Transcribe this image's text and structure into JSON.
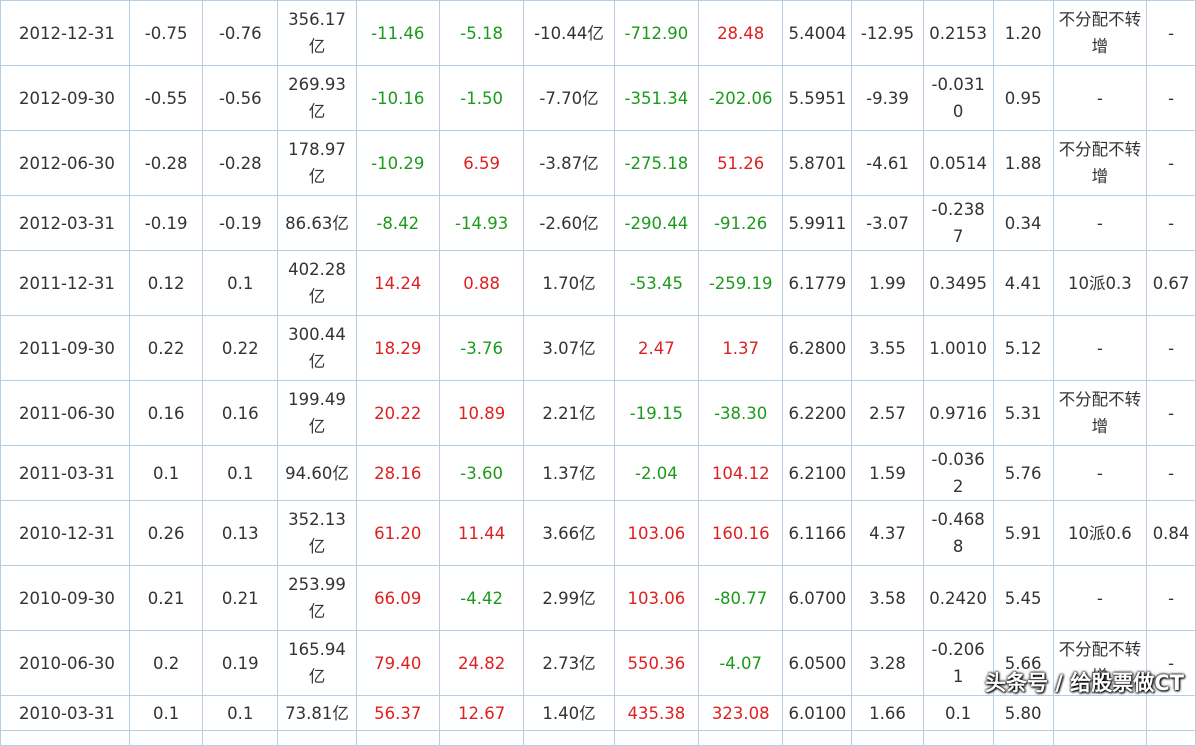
{
  "colors": {
    "up": "#e02020",
    "down": "#1c9a1c",
    "border": "#b8cfe3",
    "text": "#333333"
  },
  "rows": [
    {
      "date": "2012-12-31",
      "c1": "-0.75",
      "c2": "-0.76",
      "revenue": "356.17亿",
      "c4": "-11.46",
      "c5": "-5.18",
      "c6": "-10.44亿",
      "c7": "-712.90",
      "c8": "28.48",
      "c9": "5.4004",
      "c10": "-12.95",
      "c11": "0.2153",
      "c12": "1.20",
      "dist": "不分配不转增",
      "c14": "-"
    },
    {
      "date": "2012-09-30",
      "c1": "-0.55",
      "c2": "-0.56",
      "revenue": "269.93亿",
      "c4": "-10.16",
      "c5": "-1.50",
      "c6": "-7.70亿",
      "c7": "-351.34",
      "c8": "-202.06",
      "c9": "5.5951",
      "c10": "-9.39",
      "c11": "-0.0310",
      "c12": "0.95",
      "dist": "-",
      "c14": "-"
    },
    {
      "date": "2012-06-30",
      "c1": "-0.28",
      "c2": "-0.28",
      "revenue": "178.97亿",
      "c4": "-10.29",
      "c5": "6.59",
      "c6": "-3.87亿",
      "c7": "-275.18",
      "c8": "51.26",
      "c9": "5.8701",
      "c10": "-4.61",
      "c11": "0.0514",
      "c12": "1.88",
      "dist": "不分配不转增",
      "c14": "-"
    },
    {
      "date": "2012-03-31",
      "c1": "-0.19",
      "c2": "-0.19",
      "revenue": "86.63亿",
      "c4": "-8.42",
      "c5": "-14.93",
      "c6": "-2.60亿",
      "c7": "-290.44",
      "c8": "-91.26",
      "c9": "5.9911",
      "c10": "-3.07",
      "c11": "-0.2387",
      "c12": "0.34",
      "dist": "-",
      "c14": "-"
    },
    {
      "date": "2011-12-31",
      "c1": "0.12",
      "c2": "0.1",
      "revenue": "402.28亿",
      "c4": "14.24",
      "c5": "0.88",
      "c6": "1.70亿",
      "c7": "-53.45",
      "c8": "-259.19",
      "c9": "6.1779",
      "c10": "1.99",
      "c11": "0.3495",
      "c12": "4.41",
      "dist": "10派0.3",
      "c14": "0.67"
    },
    {
      "date": "2011-09-30",
      "c1": "0.22",
      "c2": "0.22",
      "revenue": "300.44亿",
      "c4": "18.29",
      "c5": "-3.76",
      "c6": "3.07亿",
      "c7": "2.47",
      "c8": "1.37",
      "c9": "6.2800",
      "c10": "3.55",
      "c11": "1.0010",
      "c12": "5.12",
      "dist": "-",
      "c14": "-"
    },
    {
      "date": "2011-06-30",
      "c1": "0.16",
      "c2": "0.16",
      "revenue": "199.49亿",
      "c4": "20.22",
      "c5": "10.89",
      "c6": "2.21亿",
      "c7": "-19.15",
      "c8": "-38.30",
      "c9": "6.2200",
      "c10": "2.57",
      "c11": "0.9716",
      "c12": "5.31",
      "dist": "不分配不转增",
      "c14": "-"
    },
    {
      "date": "2011-03-31",
      "c1": "0.1",
      "c2": "0.1",
      "revenue": "94.60亿",
      "c4": "28.16",
      "c5": "-3.60",
      "c6": "1.37亿",
      "c7": "-2.04",
      "c8": "104.12",
      "c9": "6.2100",
      "c10": "1.59",
      "c11": "-0.0362",
      "c12": "5.76",
      "dist": "-",
      "c14": "-"
    },
    {
      "date": "2010-12-31",
      "c1": "0.26",
      "c2": "0.13",
      "revenue": "352.13亿",
      "c4": "61.20",
      "c5": "11.44",
      "c6": "3.66亿",
      "c7": "103.06",
      "c8": "160.16",
      "c9": "6.1166",
      "c10": "4.37",
      "c11": "-0.4688",
      "c12": "5.91",
      "dist": "10派0.6",
      "c14": "0.84"
    },
    {
      "date": "2010-09-30",
      "c1": "0.21",
      "c2": "0.21",
      "revenue": "253.99亿",
      "c4": "66.09",
      "c5": "-4.42",
      "c6": "2.99亿",
      "c7": "103.06",
      "c8": "-80.77",
      "c9": "6.0700",
      "c10": "3.58",
      "c11": "0.2420",
      "c12": "5.45",
      "dist": "-",
      "c14": "-"
    },
    {
      "date": "2010-06-30",
      "c1": "0.2",
      "c2": "0.19",
      "revenue": "165.94亿",
      "c4": "79.40",
      "c5": "24.82",
      "c6": "2.73亿",
      "c7": "550.36",
      "c8": "-4.07",
      "c9": "6.0500",
      "c10": "3.28",
      "c11": "-0.2061",
      "c12": "5.66",
      "dist": "不分配不转增",
      "c14": "-"
    },
    {
      "date": "2010-03-31",
      "c1": "0.1",
      "c2": "0.1",
      "revenue": "73.81亿",
      "c4": "56.37",
      "c5": "12.67",
      "c6": "1.40亿",
      "c7": "435.38",
      "c8": "323.08",
      "c9": "6.0100",
      "c10": "1.66",
      "c11": "0.1",
      "c12": "5.80",
      "dist": "",
      "c14": ""
    }
  ],
  "watermark": "头条号 / 给股票做CT"
}
